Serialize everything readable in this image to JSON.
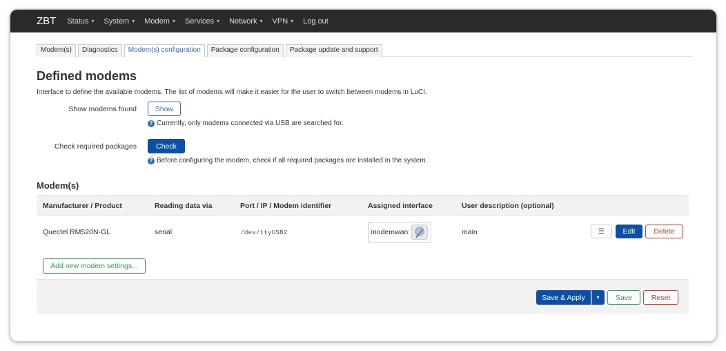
{
  "navbar": {
    "brand": "ZBT",
    "items": [
      {
        "label": "Status",
        "has_caret": true
      },
      {
        "label": "System",
        "has_caret": true
      },
      {
        "label": "Modem",
        "has_caret": true
      },
      {
        "label": "Services",
        "has_caret": true
      },
      {
        "label": "Network",
        "has_caret": true
      },
      {
        "label": "VPN",
        "has_caret": true
      },
      {
        "label": "Log out",
        "has_caret": false
      }
    ],
    "caret": "▾"
  },
  "tabs": [
    {
      "label": "Modem(s)",
      "active": false
    },
    {
      "label": "Diagnostics",
      "active": false
    },
    {
      "label": "Modem(s) configuration",
      "active": true
    },
    {
      "label": "Package configuration",
      "active": false
    },
    {
      "label": "Package update and support",
      "active": false
    }
  ],
  "page": {
    "title": "Defined modems",
    "subtitle": "Interface to define the available modems. The list of modems will make it easier for the user to switch between modems in LuCI."
  },
  "show_modems": {
    "label": "Show modems found",
    "button": "Show",
    "hint": "Currently, only modems connected via USB are searched for."
  },
  "check_packages": {
    "label": "Check required packages",
    "button": "Check",
    "hint": "Before configuring the modem, check if all required packages are installed in the system."
  },
  "modems_section": {
    "title": "Modem(s)",
    "columns": [
      "Manufacturer / Product",
      "Reading data via",
      "Port / IP / Modem identifier",
      "Assigned interface",
      "User description (optional)"
    ],
    "rows": [
      {
        "product": "Quectel RM520N-GL",
        "reading": "serial",
        "port": "/dev/ttyUSB2",
        "interface": "modemwan:",
        "description": "main"
      }
    ],
    "row_actions": {
      "menu": "☰",
      "edit": "Edit",
      "delete": "Delete"
    },
    "add_button": "Add new modem settings..."
  },
  "footer": {
    "save_apply": "Save & Apply",
    "dropdown": "▾",
    "save": "Save",
    "reset": "Reset"
  },
  "icons": {
    "help": "?",
    "network": "network-interface-icon"
  },
  "colors": {
    "navbar_bg": "#2a2a2a",
    "primary": "#0d4fa8",
    "link": "#2e70b8",
    "success": "#2ea44f",
    "danger": "#d9342b"
  }
}
